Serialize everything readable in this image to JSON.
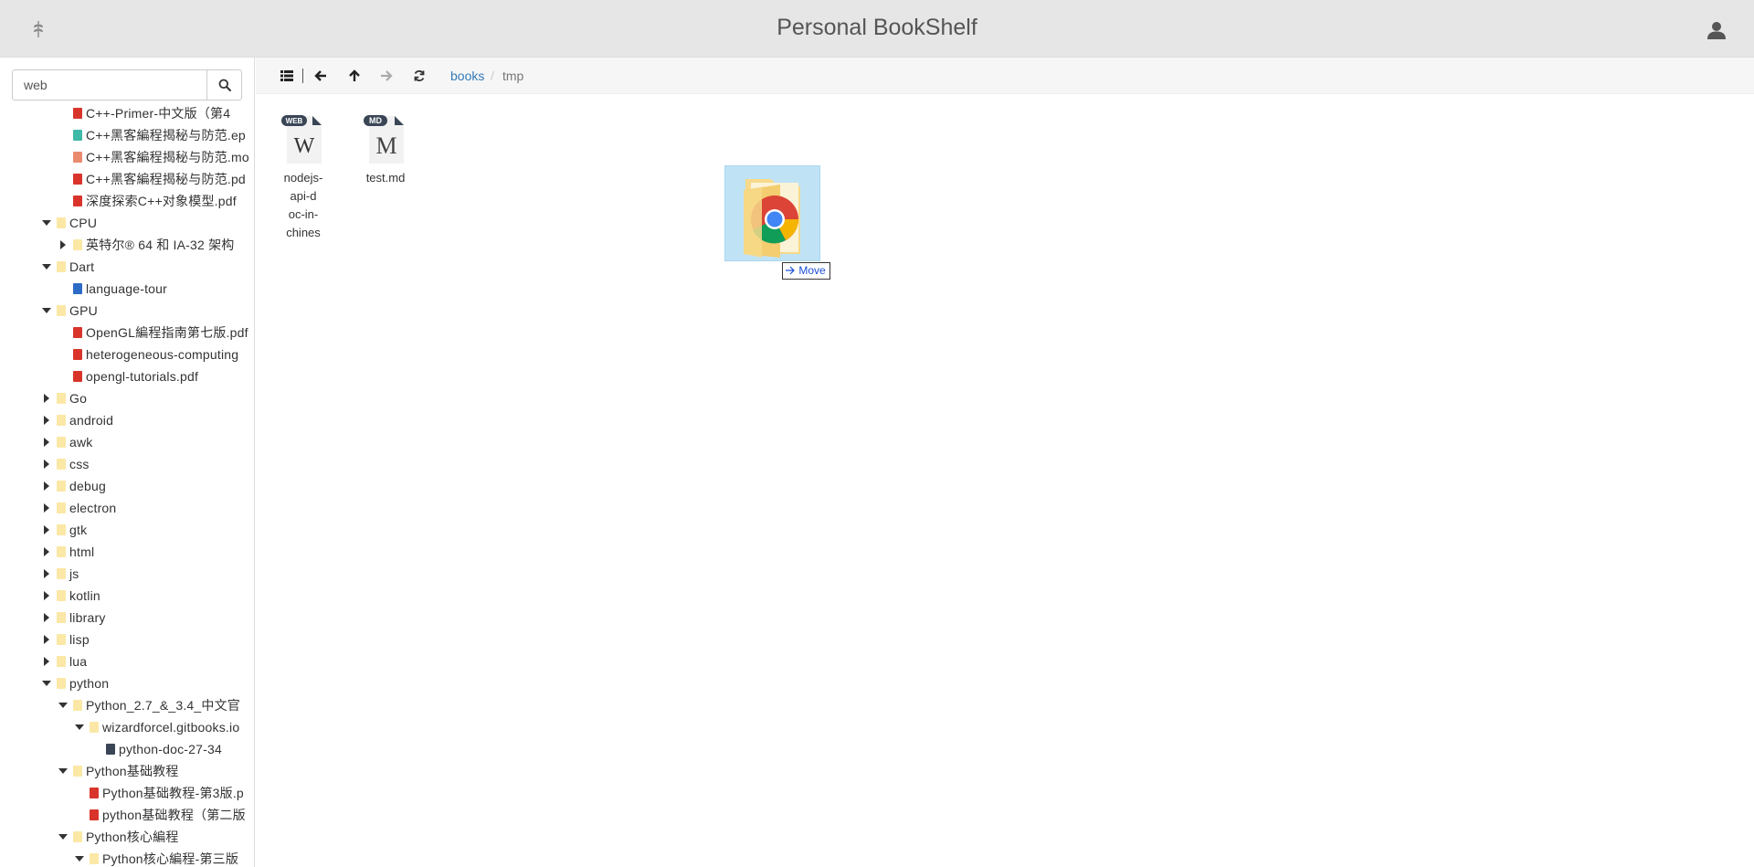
{
  "header": {
    "title": "Personal BookShelf",
    "logo_icon": "leaf-logo-icon",
    "user_icon": "user-icon"
  },
  "search": {
    "value": "web",
    "placeholder": "",
    "button_icon": "search-icon"
  },
  "tree": [
    {
      "label": "C++-Primer-中文版（第4",
      "type": "pdf",
      "arrow": "none",
      "depth": 4
    },
    {
      "label": "C++黑客編程揭秘与防范.ep",
      "type": "epub",
      "arrow": "none",
      "depth": 4
    },
    {
      "label": "C++黑客編程揭秘与防范.mo",
      "type": "mobi",
      "arrow": "none",
      "depth": 4
    },
    {
      "label": "C++黑客編程揭秘与防范.pd",
      "type": "pdf",
      "arrow": "none",
      "depth": 4
    },
    {
      "label": "深度探索C++对象模型.pdf",
      "type": "pdf",
      "arrow": "none",
      "depth": 4
    },
    {
      "label": "CPU",
      "type": "folder",
      "arrow": "expanded",
      "depth": 3
    },
    {
      "label": "英特尔® 64 和 IA-32 架构",
      "type": "folder",
      "arrow": "collapsed",
      "depth": 4
    },
    {
      "label": "Dart",
      "type": "folder",
      "arrow": "expanded",
      "depth": 3
    },
    {
      "label": "language-tour",
      "type": "doc",
      "arrow": "none",
      "depth": 4
    },
    {
      "label": "GPU",
      "type": "folder",
      "arrow": "expanded",
      "depth": 3
    },
    {
      "label": "OpenGL編程指南第七版.pdf",
      "type": "pdf",
      "arrow": "none",
      "depth": 4
    },
    {
      "label": "heterogeneous-computing",
      "type": "pdf",
      "arrow": "none",
      "depth": 4
    },
    {
      "label": "opengl-tutorials.pdf",
      "type": "pdf",
      "arrow": "none",
      "depth": 4
    },
    {
      "label": "Go",
      "type": "folder",
      "arrow": "collapsed",
      "depth": 3
    },
    {
      "label": "android",
      "type": "folder",
      "arrow": "collapsed",
      "depth": 3
    },
    {
      "label": "awk",
      "type": "folder",
      "arrow": "collapsed",
      "depth": 3
    },
    {
      "label": "css",
      "type": "folder",
      "arrow": "collapsed",
      "depth": 3
    },
    {
      "label": "debug",
      "type": "folder",
      "arrow": "collapsed",
      "depth": 3
    },
    {
      "label": "electron",
      "type": "folder",
      "arrow": "collapsed",
      "depth": 3
    },
    {
      "label": "gtk",
      "type": "folder",
      "arrow": "collapsed",
      "depth": 3
    },
    {
      "label": "html",
      "type": "folder",
      "arrow": "collapsed",
      "depth": 3
    },
    {
      "label": "js",
      "type": "folder",
      "arrow": "collapsed",
      "depth": 3
    },
    {
      "label": "kotlin",
      "type": "folder",
      "arrow": "collapsed",
      "depth": 3
    },
    {
      "label": "library",
      "type": "folder",
      "arrow": "collapsed",
      "depth": 3
    },
    {
      "label": "lisp",
      "type": "folder",
      "arrow": "collapsed",
      "depth": 3
    },
    {
      "label": "lua",
      "type": "folder",
      "arrow": "collapsed",
      "depth": 3
    },
    {
      "label": "python",
      "type": "folder",
      "arrow": "expanded",
      "depth": 3
    },
    {
      "label": "Python_2.7_&_3.4_中文官",
      "type": "folder",
      "arrow": "expanded",
      "depth": 4
    },
    {
      "label": "wizardforcel.gitbooks.io",
      "type": "folder",
      "arrow": "expanded",
      "depth": 5
    },
    {
      "label": "python-doc-27-34",
      "type": "dark",
      "arrow": "none",
      "depth": 6
    },
    {
      "label": "Python基础教程",
      "type": "folder",
      "arrow": "expanded",
      "depth": 4
    },
    {
      "label": "Python基础教程-第3版.p",
      "type": "pdf",
      "arrow": "none",
      "depth": 5
    },
    {
      "label": "python基础教程（第二版",
      "type": "pdf",
      "arrow": "none",
      "depth": 5
    },
    {
      "label": "Python核心編程",
      "type": "folder",
      "arrow": "expanded",
      "depth": 4
    },
    {
      "label": "Python核心編程-第三版",
      "type": "folder",
      "arrow": "expanded",
      "depth": 5
    }
  ],
  "toolbar": {
    "list_icon": "list-view-icon",
    "back_icon": "arrow-left-icon",
    "up_icon": "arrow-up-icon",
    "forward_icon": "arrow-right-icon",
    "refresh_icon": "refresh-icon"
  },
  "breadcrumb": {
    "root": "books",
    "separator": "/",
    "current": "tmp"
  },
  "files": [
    {
      "name_line1": "nodejs-api-d",
      "name_line2": "oc-in-chines",
      "badge": "WEB",
      "glyph": "W",
      "icon": "web-document-icon"
    },
    {
      "name_line1": "test.md",
      "name_line2": "",
      "badge": "MD",
      "glyph": "M",
      "icon": "markdown-document-icon"
    }
  ],
  "drag": {
    "icon": "chrome-folder-icon",
    "tooltip": "Move",
    "tooltip_icon": "move-arrow-icon"
  },
  "colors": {
    "header_bg": "#e6e6e6",
    "link": "#337ab7",
    "pdf": "#d9342b",
    "folder": "#fbe8a6",
    "drag_highlight": "#bfe3f5"
  }
}
